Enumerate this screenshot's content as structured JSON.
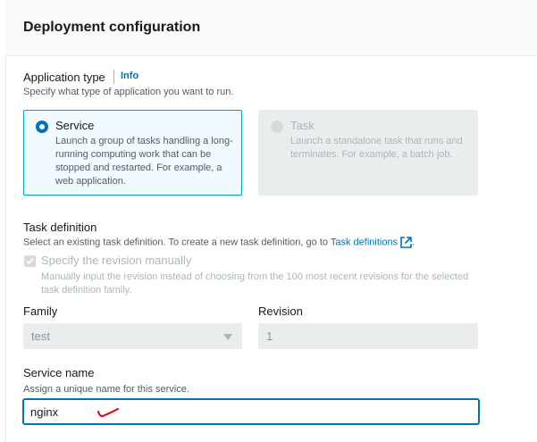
{
  "section": {
    "title": "Deployment configuration"
  },
  "application_type": {
    "label": "Application type",
    "info_link": "Info",
    "description": "Specify what type of application you want to run.",
    "options": [
      {
        "title": "Service",
        "description": "Launch a group of tasks handling a long-running computing work that can be stopped and restarted. For example, a web application.",
        "selected": true,
        "disabled": false
      },
      {
        "title": "Task",
        "description": "Launch a standalone task that runs and terminates. For example, a batch job.",
        "selected": false,
        "disabled": true
      }
    ]
  },
  "task_definition": {
    "label": "Task definition",
    "description_prefix": "Select an existing task definition. To create a new task definition, go to",
    "link_text": "Task definitions",
    "description_suffix": ".",
    "revision_checkbox": {
      "label": "Specify the revision manually",
      "description": "Manually input the revision instead of choosing from the 100 most recent revisions for the selected task definition family.",
      "checked": true,
      "disabled": true
    },
    "family": {
      "label": "Family",
      "value": "test"
    },
    "revision": {
      "label": "Revision",
      "value": "1"
    }
  },
  "service_name": {
    "label": "Service name",
    "description": "Assign a unique name for this service.",
    "value": "nginx"
  },
  "colors": {
    "accent": "#0073bb",
    "selected_border": "#00a1c9",
    "annotation": "#e0001a"
  }
}
